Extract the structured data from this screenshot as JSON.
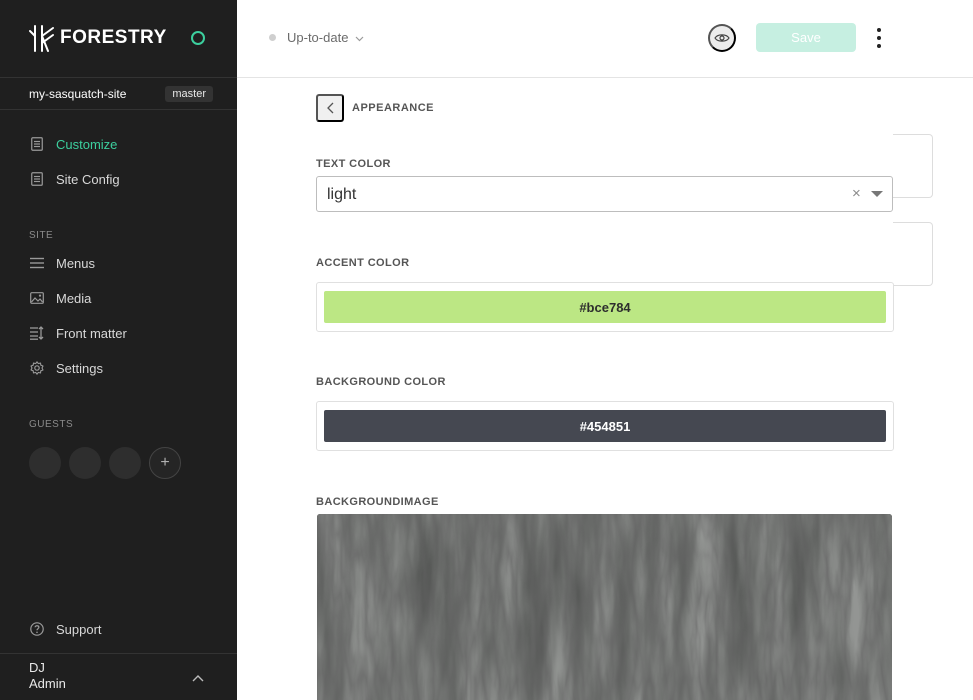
{
  "sidebar": {
    "brand": "FORESTRY",
    "site_name": "my-sasquatch-site",
    "branch": "master",
    "primary_nav": [
      {
        "label": "Customize",
        "icon": "document-icon",
        "active": true
      },
      {
        "label": "Site Config",
        "icon": "document-icon",
        "active": false
      }
    ],
    "site_section_label": "SITE",
    "site_nav": [
      {
        "label": "Menus",
        "icon": "menu-icon"
      },
      {
        "label": "Media",
        "icon": "image-icon"
      },
      {
        "label": "Front matter",
        "icon": "front-matter-icon"
      },
      {
        "label": "Settings",
        "icon": "gear-icon"
      }
    ],
    "guests_label": "GUESTS",
    "guest_add": "+",
    "support": "Support",
    "user": {
      "name": "DJ",
      "role": "Admin"
    }
  },
  "topbar": {
    "status": "Up-to-date",
    "save_label": "Save"
  },
  "panel": {
    "title": "APPEARANCE",
    "text_color": {
      "label": "TEXT COLOR",
      "value": "light",
      "clear": "×"
    },
    "accent_color": {
      "label": "ACCENT COLOR",
      "value": "#bce784"
    },
    "background_color": {
      "label": "BACKGROUND COLOR",
      "value": "#454851"
    },
    "background_image": {
      "label": "BACKGROUNDIMAGE"
    }
  },
  "colors": {
    "accent": "#3ccf9e",
    "sidebar_bg": "#1f1f1f",
    "save_disabled": "#c6efe1"
  }
}
